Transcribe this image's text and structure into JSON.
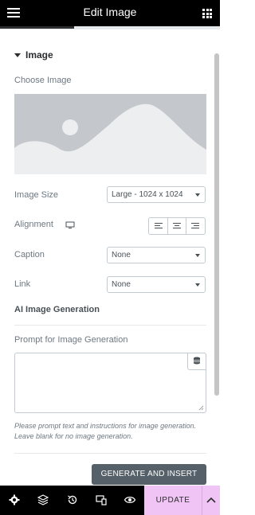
{
  "header": {
    "title": "Edit Image"
  },
  "section": {
    "title": "Image"
  },
  "fields": {
    "choose_image_label": "Choose Image",
    "image_size_label": "Image Size",
    "image_size_value": "Large - 1024 x 1024",
    "alignment_label": "Alignment",
    "caption_label": "Caption",
    "caption_value": "None",
    "link_label": "Link",
    "link_value": "None"
  },
  "ai": {
    "title": "AI Image Generation",
    "prompt_label": "Prompt for Image Generation",
    "prompt_value": "",
    "help": "Please prompt text and instructions for image generation. Leave blank for no image generation.",
    "generate_label": "GENERATE AND INSERT"
  },
  "footer": {
    "update_label": "UPDATE"
  },
  "colors": {
    "topbar": "#000000",
    "update_bg": "#f0c5f5",
    "button": "#556068"
  }
}
